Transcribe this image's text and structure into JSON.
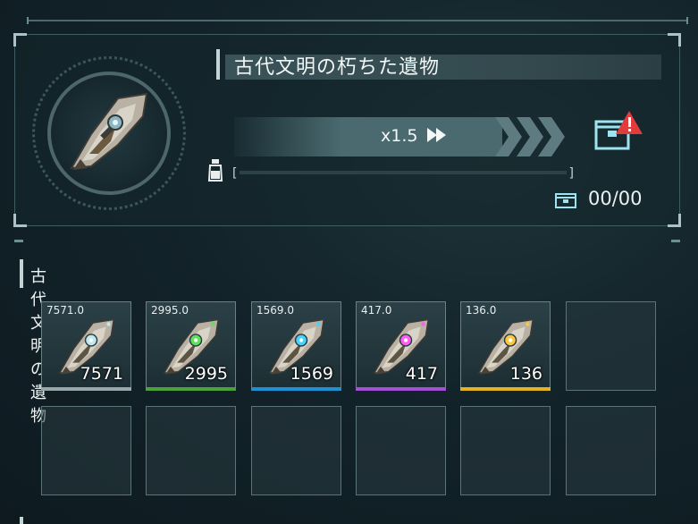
{
  "relic": {
    "title": "古代文明の朽ちた遺物",
    "speed_label": "x1.5",
    "progress_fraction": 0.0,
    "ratio": "00/00",
    "alert_color": "#e23b3b"
  },
  "inventory": {
    "section_title": "古代文明の遺物",
    "items": [
      {
        "top_label": "7571.0",
        "count": "7571",
        "rarity_color": "#9aa7aa",
        "gem_color": "#bfe8f0"
      },
      {
        "top_label": "2995.0",
        "count": "2995",
        "rarity_color": "#4aa33a",
        "gem_color": "#5fe05a"
      },
      {
        "top_label": "1569.0",
        "count": "1569",
        "rarity_color": "#1f8fd6",
        "gem_color": "#45d2ff"
      },
      {
        "top_label": "417.0",
        "count": "417",
        "rarity_color": "#a44fd6",
        "gem_color": "#ff5cf2"
      },
      {
        "top_label": "136.0",
        "count": "136",
        "rarity_color": "#e6b320",
        "gem_color": "#ffc83c"
      }
    ]
  }
}
